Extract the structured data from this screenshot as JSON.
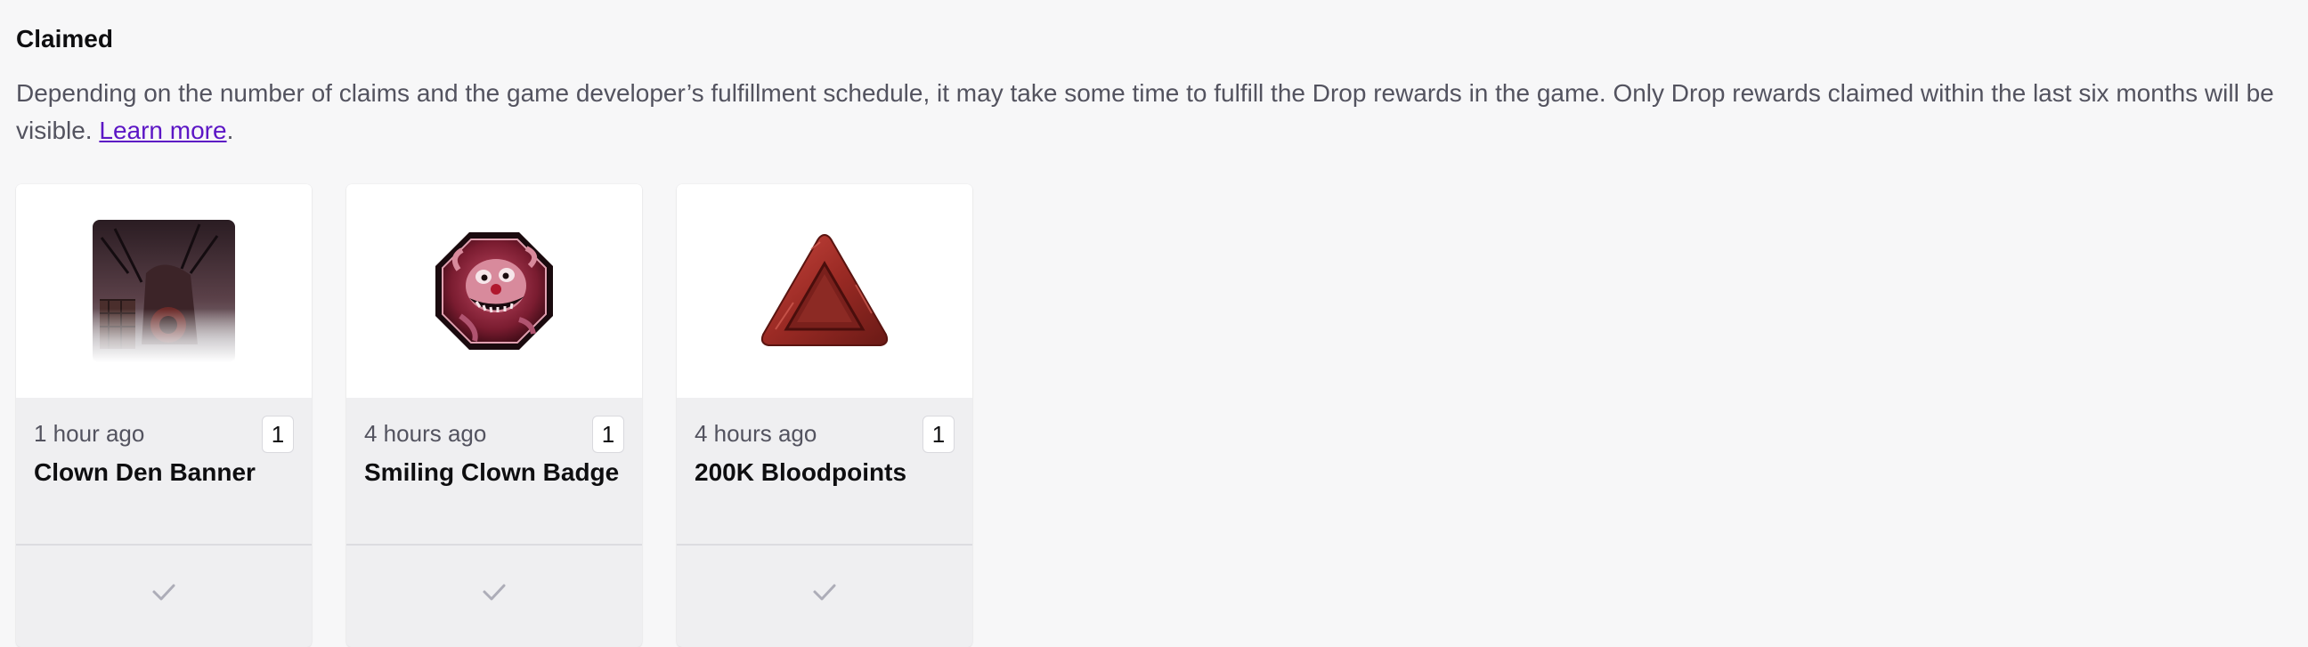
{
  "section": {
    "title": "Claimed",
    "description": "Depending on the number of claims and the game developer’s fulfillment schedule, it may take some time to fulfill the Drop rewards in the game. Only Drop rewards claimed within the last six months will be visible.",
    "learn_more_label": "Learn more",
    "trailing_period": "."
  },
  "cards": [
    {
      "time": "1 hour ago",
      "count": "1",
      "name": "Clown Den Banner",
      "icon": "clown-den-banner-image",
      "status_icon": "check-icon"
    },
    {
      "time": "4 hours ago",
      "count": "1",
      "name": "Smiling Clown Badge",
      "icon": "smiling-clown-badge-image",
      "status_icon": "check-icon"
    },
    {
      "time": "4 hours ago",
      "count": "1",
      "name": "200K Bloodpoints",
      "icon": "bloodpoints-triangle-image",
      "status_icon": "check-icon"
    }
  ],
  "colors": {
    "link": "#5c16c5",
    "card_bg": "#efeff1",
    "page_bg": "#f7f7f8",
    "check": "#adadb8"
  }
}
